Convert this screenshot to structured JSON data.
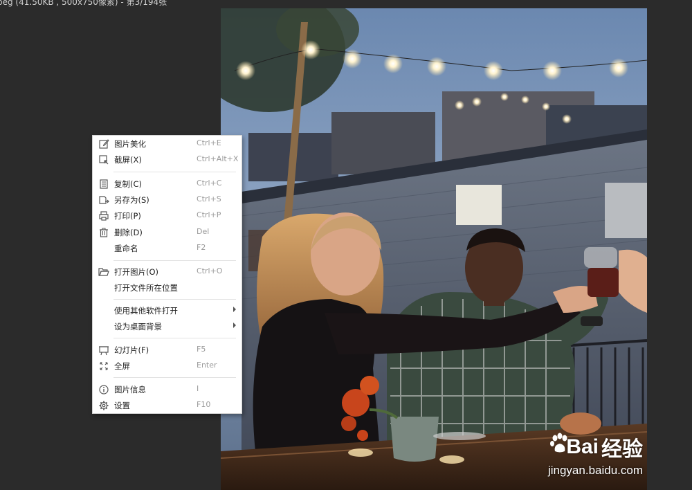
{
  "window": {
    "title": "peg (41.50KB , 500x750像素) - 第3/194张"
  },
  "context_menu": {
    "items": [
      {
        "label": "图片美化",
        "shortcut": "Ctrl+E",
        "icon": "edit-icon"
      },
      {
        "label": "截屏(X)",
        "shortcut": "Ctrl+Alt+X",
        "icon": "screenshot-icon"
      },
      {
        "label": "复制(C)",
        "shortcut": "Ctrl+C",
        "icon": "copy-icon"
      },
      {
        "label": "另存为(S)",
        "shortcut": "Ctrl+S",
        "icon": "save-as-icon"
      },
      {
        "label": "打印(P)",
        "shortcut": "Ctrl+P",
        "icon": "printer-icon"
      },
      {
        "label": "删除(D)",
        "shortcut": "Del",
        "icon": "trash-icon"
      },
      {
        "label": "重命名",
        "shortcut": "F2",
        "icon": ""
      },
      {
        "label": "打开图片(O)",
        "shortcut": "Ctrl+O",
        "icon": "folder-open-icon"
      },
      {
        "label": "打开文件所在位置",
        "shortcut": "",
        "icon": ""
      },
      {
        "label": "使用其他软件打开",
        "shortcut": "",
        "icon": "",
        "submenu": true
      },
      {
        "label": "设为桌面背景",
        "shortcut": "",
        "icon": "",
        "submenu": true
      },
      {
        "label": "幻灯片(F)",
        "shortcut": "F5",
        "icon": "slideshow-icon"
      },
      {
        "label": "全屏",
        "shortcut": "Enter",
        "icon": "fullscreen-icon"
      },
      {
        "label": "图片信息",
        "shortcut": "I",
        "icon": "info-icon"
      },
      {
        "label": "设置",
        "shortcut": "F10",
        "icon": "settings-gear-icon"
      }
    ]
  },
  "watermark": {
    "brand_left": "Bai",
    "brand_right": "经验",
    "url": "jingyan.baidu.com"
  },
  "colors": {
    "background": "#2b2b2b",
    "menu_bg": "#ffffff",
    "shortcut_text": "#9a9a9a"
  }
}
